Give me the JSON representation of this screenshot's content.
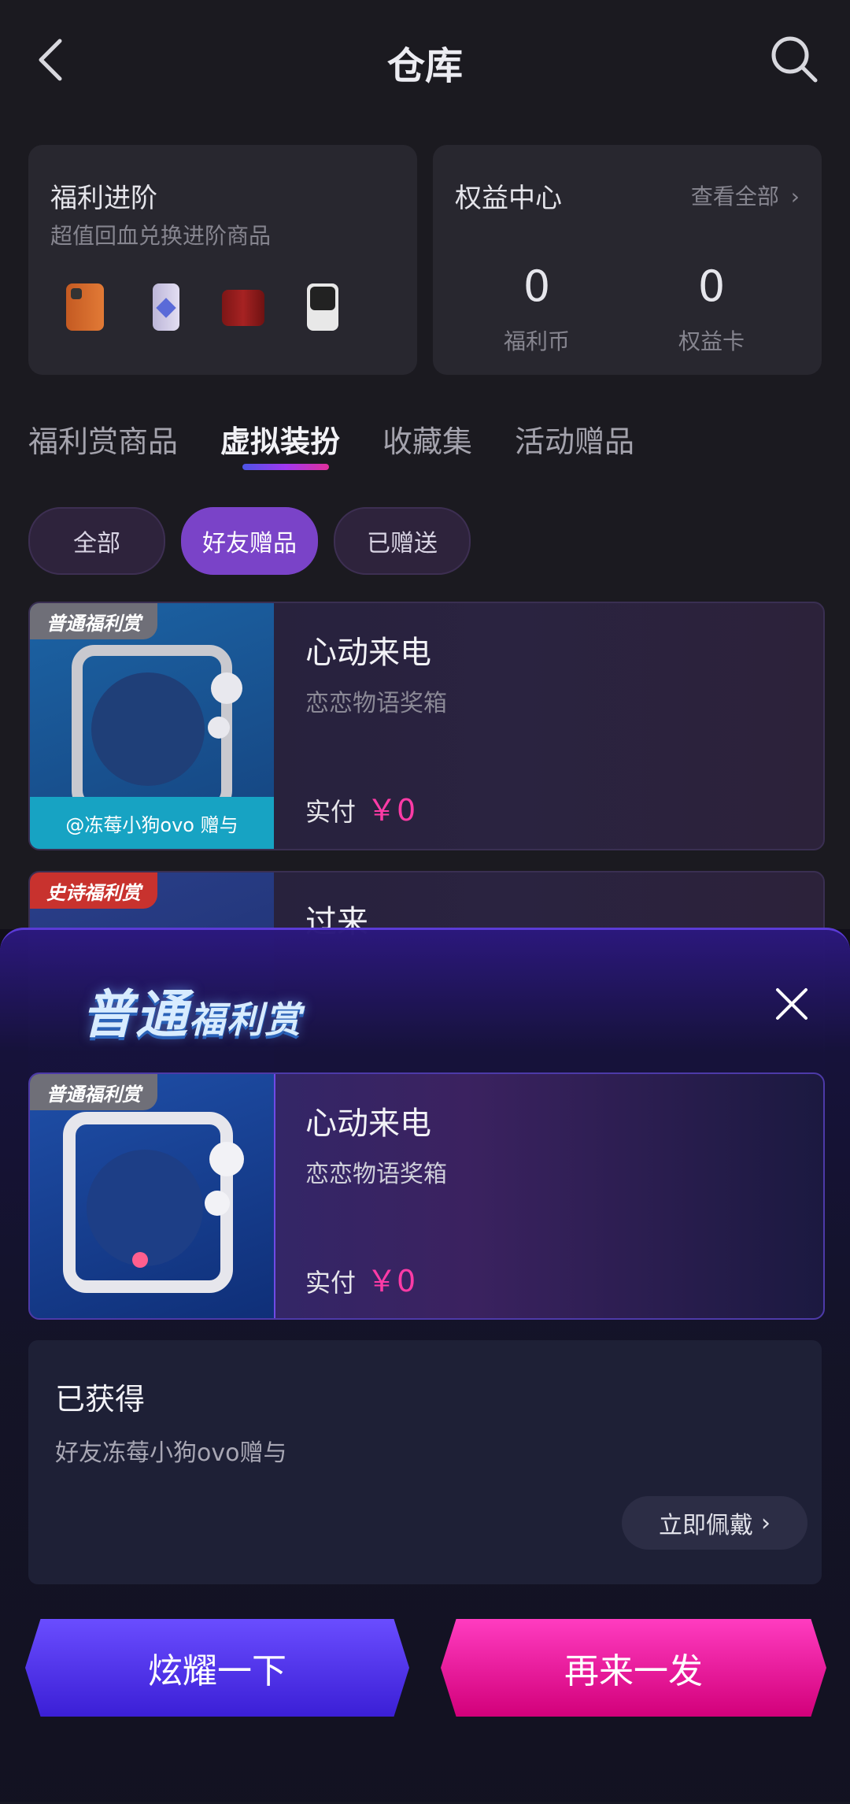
{
  "header": {
    "title": "仓库",
    "back_icon": "chevron-left-icon",
    "search_icon": "search-icon"
  },
  "welfare_card": {
    "title": "福利进阶",
    "subtitle": "超值回血兑换进阶商品",
    "products": [
      "orange-phone",
      "purple-phone",
      "red-phone",
      "black-phone"
    ]
  },
  "rights_card": {
    "title": "权益中心",
    "view_all": "查看全部",
    "stats": [
      {
        "value": "0",
        "label": "福利币"
      },
      {
        "value": "0",
        "label": "权益卡"
      }
    ]
  },
  "tabs": [
    {
      "label": "福利赏商品"
    },
    {
      "label": "虚拟装扮",
      "active": true
    },
    {
      "label": "收藏集"
    },
    {
      "label": "活动赠品"
    }
  ],
  "filters": [
    {
      "label": "全部"
    },
    {
      "label": "好友赠品",
      "active": true
    },
    {
      "label": "已赠送"
    }
  ],
  "items": [
    {
      "rarity": "普通福利赏",
      "title": "心动来电",
      "subtitle": "恋恋物语奖箱",
      "pay_label": "实付",
      "price": "￥0",
      "gift_from": "@冻莓小狗ovo 赠与"
    },
    {
      "rarity": "史诗福利赏",
      "title": "过来"
    }
  ],
  "modal": {
    "logo_big": "普通",
    "logo_small": "福利赏",
    "item": {
      "rarity": "普通福利赏",
      "title": "心动来电",
      "subtitle": "恋恋物语奖箱",
      "pay_label": "实付",
      "price": "￥0"
    },
    "obtained_title": "已获得",
    "obtained_desc": "好友冻莓小狗ovo赠与",
    "wear_button": "立即佩戴",
    "show_button": "炫耀一下",
    "again_button": "再来一发"
  },
  "colors": {
    "accent_pink": "#ff3ba6",
    "accent_purple": "#7a43c8",
    "bg": "#1b1a20"
  }
}
